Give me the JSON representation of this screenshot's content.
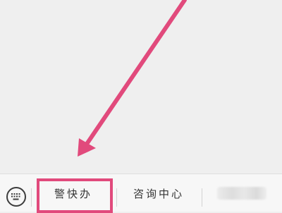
{
  "annotation": {
    "color": "#e14a7c"
  },
  "keyboard_toggle": {
    "icon": "keyboard-icon"
  },
  "menu": {
    "items": [
      {
        "label": "警快办"
      },
      {
        "label": "咨询中心"
      },
      {
        "label": ""
      }
    ]
  }
}
